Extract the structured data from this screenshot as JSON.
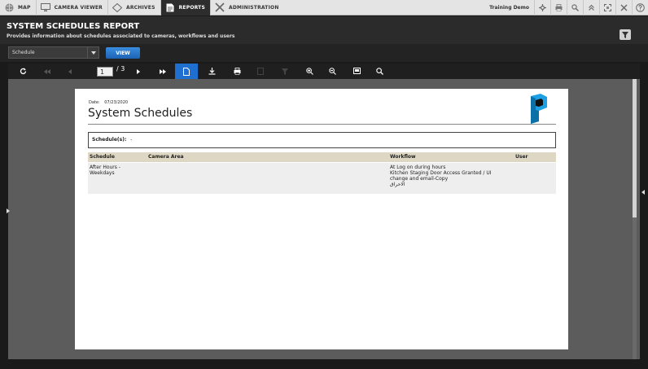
{
  "nav": {
    "tabs": [
      {
        "label": "MAP",
        "icon": "globe-icon"
      },
      {
        "label": "CAMERA VIEWER",
        "icon": "monitor-icon"
      },
      {
        "label": "ARCHIVES",
        "icon": "archive-icon"
      },
      {
        "label": "REPORTS",
        "icon": "report-icon"
      },
      {
        "label": "ADMINISTRATION",
        "icon": "tools-icon"
      }
    ],
    "site_name": "Training Demo"
  },
  "header": {
    "title": "SYSTEM SCHEDULES REPORT",
    "description": "Provides information about schedules associated to cameras, workflows and users"
  },
  "controls": {
    "select_value": "Schedule",
    "view_label": "VIEW"
  },
  "viewer": {
    "current_page": "1",
    "total_pages": "/ 3"
  },
  "report": {
    "date_label": "Date:",
    "date_value": "07/23/2020",
    "title": "System Schedules",
    "schedules_label": "Schedule(s):",
    "schedules_value": "-",
    "columns": [
      "Schedule",
      "Camera Area",
      "Workflow",
      "User"
    ],
    "row": {
      "schedule_line1": "After Hours -",
      "schedule_line2": "Weekdays",
      "camera_area": "",
      "workflow_line1": "At Log on during hours",
      "workflow_line2": "Kitchen Staging Door Access Granted / UI",
      "workflow_line3": "change and email-Copy",
      "workflow_line4": "الاحراق",
      "user": ""
    }
  },
  "colors": {
    "accent": "#1e6fd0",
    "table_header": "#ded7c3",
    "logo_blue": "#1da1e4"
  }
}
